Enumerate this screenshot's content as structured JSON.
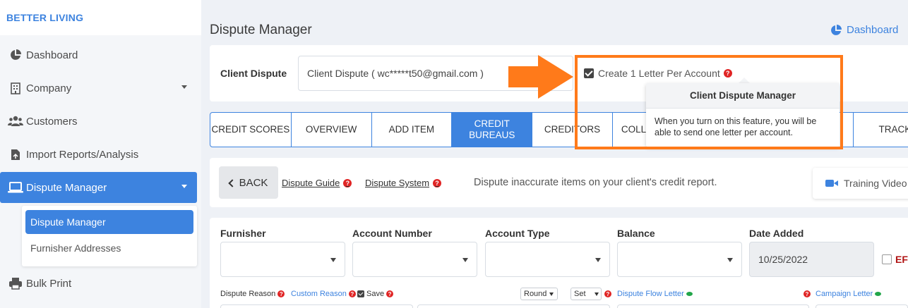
{
  "brand": "BETTER LIVING",
  "sidebar": {
    "items": [
      {
        "label": "Dashboard",
        "icon": "pie-chart-icon"
      },
      {
        "label": "Company",
        "icon": "building-icon"
      },
      {
        "label": "Customers",
        "icon": "users-icon"
      },
      {
        "label": "Import Reports/Analysis",
        "icon": "file-import-icon"
      },
      {
        "label": "Dispute Manager",
        "icon": "laptop-icon"
      },
      {
        "label": "Bulk Print",
        "icon": "printer-icon"
      }
    ],
    "submenu": [
      "Dispute Manager",
      "Furnisher Addresses"
    ]
  },
  "header": {
    "title": "Dispute Manager",
    "dashboard_link": "Dashboard"
  },
  "client": {
    "label": "Client Dispute",
    "value": "Client Dispute ( wc*****t50@gmail.com )",
    "checkbox_label": "Create 1 Letter Per Account"
  },
  "tooltip": {
    "title": "Client Dispute Manager",
    "body": "When you turn on this feature, you will be able to send one letter per account."
  },
  "tabs": [
    {
      "label": "CREDIT SCORES"
    },
    {
      "label": "OVERVIEW"
    },
    {
      "label": "ADD ITEM"
    },
    {
      "label": "CREDIT BUREAUS"
    },
    {
      "label": "CREDITORS"
    },
    {
      "label": "COLL"
    },
    {
      "label": ""
    },
    {
      "label": ""
    },
    {
      "label": "TRACKI"
    }
  ],
  "toolbar": {
    "back": "BACK",
    "guide": "Dispute Guide",
    "system": "Dispute System",
    "description": "Dispute inaccurate items on your client's credit report.",
    "training": "Training Video"
  },
  "form": {
    "columns": [
      "Furnisher",
      "Account Number",
      "Account Type",
      "Balance",
      "Date Added"
    ],
    "date_value": "10/25/2022",
    "ef_label": "EF",
    "dispute_reason": "Dispute Reason",
    "custom_reason": "Custom Reason",
    "save": "Save",
    "round": "Round",
    "set": "Set",
    "flow_letter": "Dispute Flow Letter",
    "campaign_letter": "Campaign Letter"
  },
  "colors": {
    "accent": "#3d83df",
    "highlight": "#ff7a1a",
    "help": "#e02424"
  }
}
